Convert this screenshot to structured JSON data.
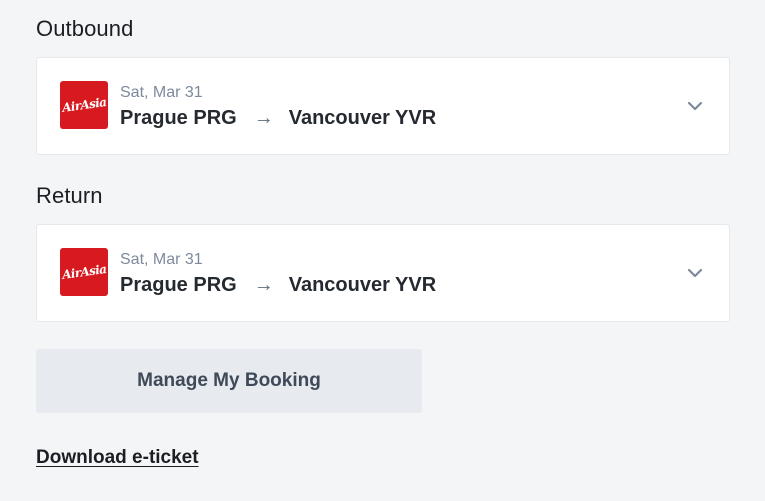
{
  "outbound": {
    "title": "Outbound",
    "airline_logo_text": "AirAsia",
    "date": "Sat, Mar 31",
    "origin": "Prague PRG",
    "destination": "Vancouver YVR"
  },
  "return": {
    "title": "Return",
    "airline_logo_text": "AirAsia",
    "date": "Sat, Mar 31",
    "origin": "Prague PRG",
    "destination": "Vancouver YVR"
  },
  "actions": {
    "manage_booking_label": "Manage My Booking",
    "download_label": "Download e-ticket"
  },
  "icons": {
    "route_arrow": "arrow-right-icon",
    "expand": "chevron-down-icon"
  },
  "colors": {
    "airline_brand": "#d71920",
    "chevron": "#7d8a9c",
    "background": "#f4f5f7"
  }
}
